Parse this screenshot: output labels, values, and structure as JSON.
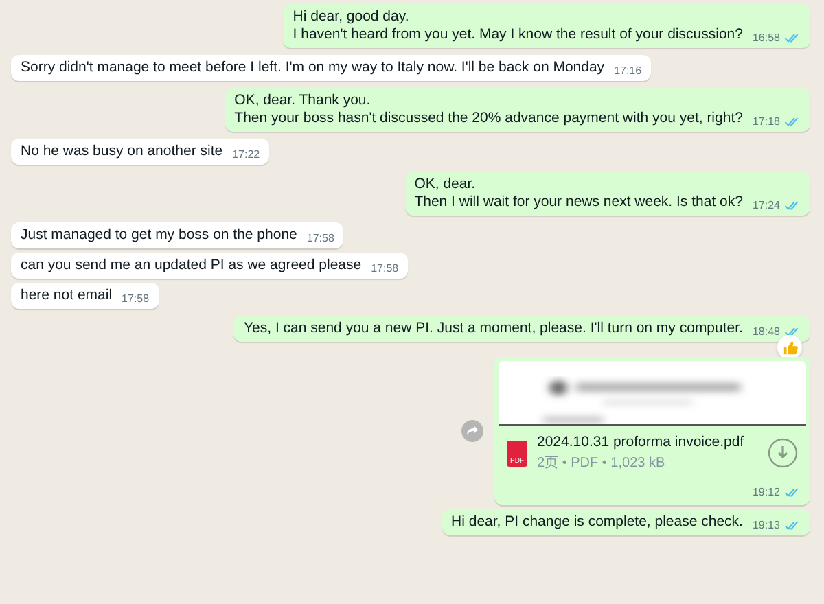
{
  "messages": [
    {
      "kind": "text",
      "outgoing": true,
      "text": "Hi dear, good day.\nI haven't heard from you yet. May I know the result of your discussion?",
      "time": "16:58",
      "read": true
    },
    {
      "kind": "text",
      "outgoing": false,
      "text": "Sorry didn't manage to meet before I left. I'm on my way to Italy now. I'll be back on Monday",
      "time": "17:16"
    },
    {
      "kind": "text",
      "outgoing": true,
      "text": "OK, dear. Thank you.\nThen your boss hasn't discussed the 20% advance payment with you yet, right?",
      "time": "17:18",
      "read": true
    },
    {
      "kind": "text",
      "outgoing": false,
      "text": "No he was busy on another site",
      "time": "17:22"
    },
    {
      "kind": "text",
      "outgoing": true,
      "text": "OK, dear.\nThen I will wait for your news next week. Is that ok?",
      "time": "17:24",
      "read": true
    },
    {
      "kind": "text",
      "outgoing": false,
      "text": "Just managed to get my boss on the phone",
      "time": "17:58"
    },
    {
      "kind": "text",
      "outgoing": false,
      "text": "can you send me an updated PI as we agreed please",
      "time": "17:58"
    },
    {
      "kind": "text",
      "outgoing": false,
      "text": "here not email",
      "time": "17:58"
    },
    {
      "kind": "text",
      "outgoing": true,
      "text": "Yes, I can send you a new PI. Just a moment, please. I'll turn on my computer.",
      "time": "18:48",
      "read": true,
      "liked": true
    },
    {
      "kind": "document",
      "outgoing": true,
      "file_name": "2024.10.31 proforma invoice.pdf",
      "file_meta": "2页 • PDF • 1,023 kB",
      "file_badge": "PDF",
      "time": "19:12",
      "read": true
    },
    {
      "kind": "text",
      "outgoing": true,
      "text": "Hi dear, PI change is complete, please check.",
      "time": "19:13",
      "read": true
    }
  ]
}
